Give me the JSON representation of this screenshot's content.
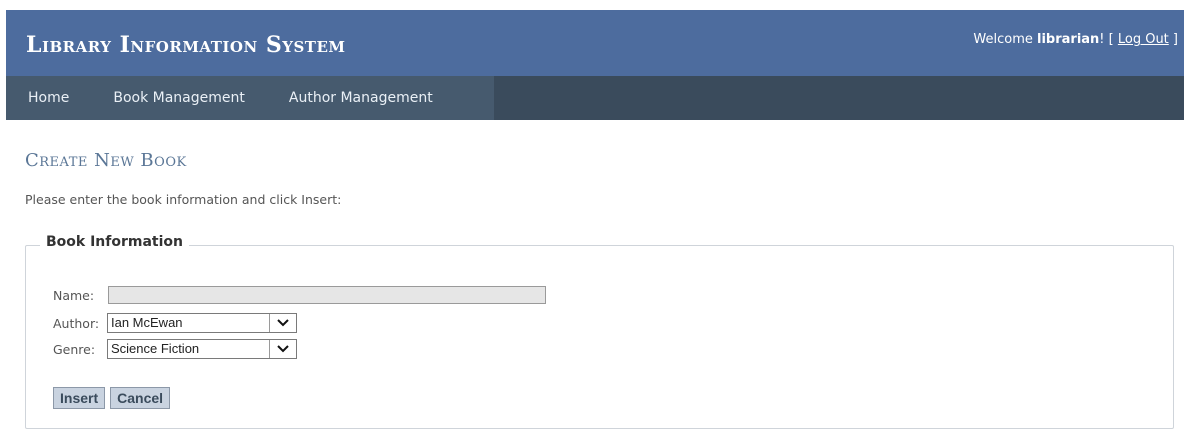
{
  "header": {
    "title": "Library Information System",
    "welcome_prefix": "Welcome ",
    "username": "librarian",
    "welcome_suffix": "! [ ",
    "logout_label": "Log Out",
    "bracket_close": " ]"
  },
  "nav": {
    "items": [
      {
        "label": "Home"
      },
      {
        "label": "Book Management"
      },
      {
        "label": "Author Management"
      }
    ]
  },
  "main": {
    "title": "Create New Book",
    "instructions": "Please enter the book information and click Insert:",
    "fieldset": {
      "legend": "Book Information",
      "name_label": "Name:",
      "name_value": "",
      "author_label": "Author:",
      "author_value": "Ian McEwan",
      "genre_label": "Genre:",
      "genre_value": "Science Fiction"
    },
    "buttons": {
      "insert_label": "Insert",
      "cancel_label": "Cancel"
    }
  },
  "colors": {
    "header_bg": "#4d6c9e",
    "nav_bg": "#3a4b5c",
    "nav_tabs_bg": "#465a6e",
    "title_color": "#5a7696",
    "button_bg": "#c9d3e0"
  },
  "icons": {
    "select_arrow": "chevron-down-icon"
  }
}
